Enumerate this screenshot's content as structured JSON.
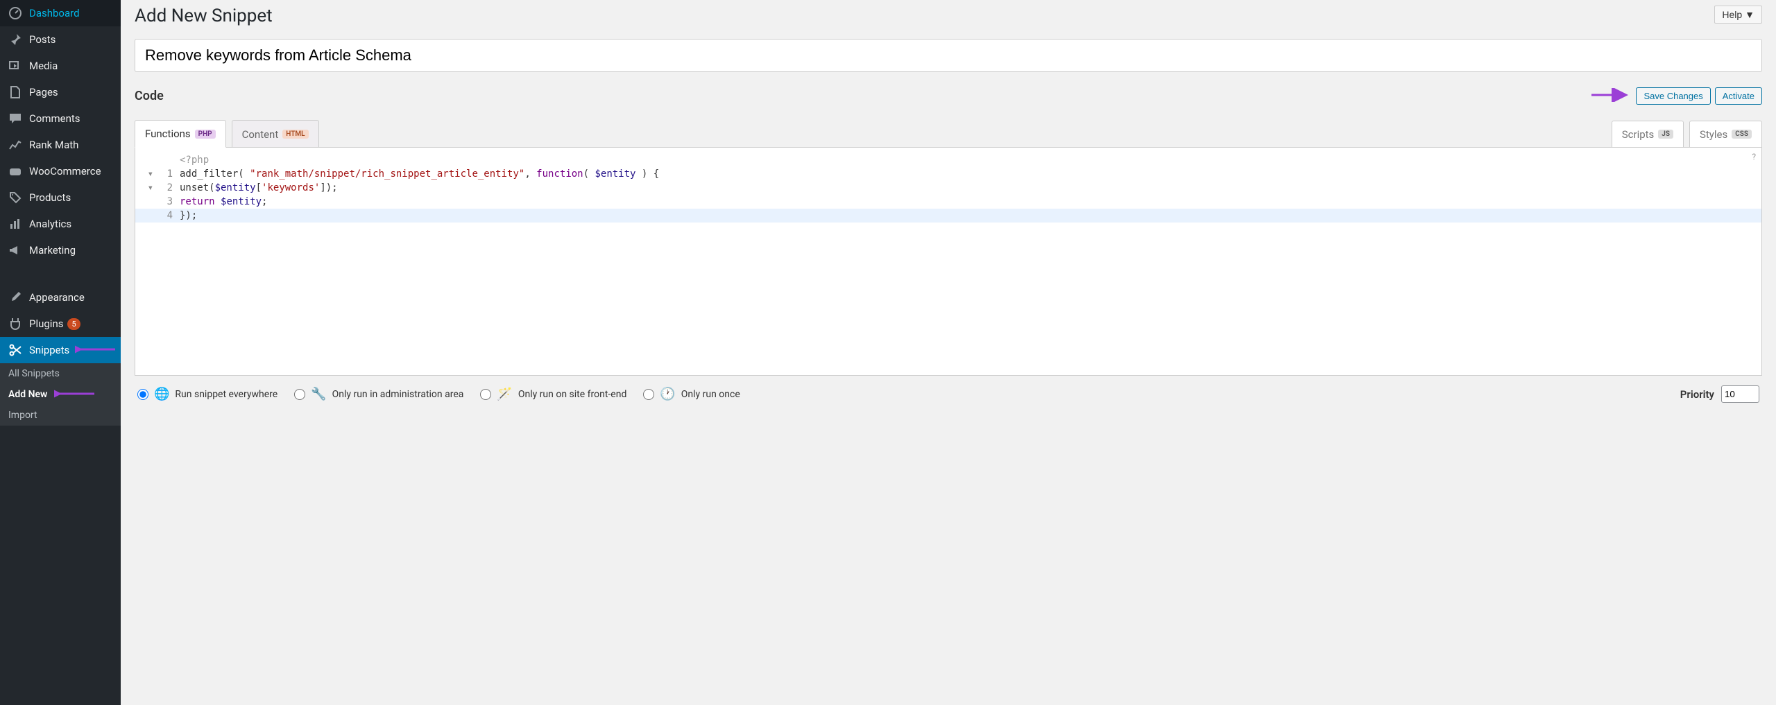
{
  "sidebar": {
    "items": [
      {
        "label": "Dashboard"
      },
      {
        "label": "Posts"
      },
      {
        "label": "Media"
      },
      {
        "label": "Pages"
      },
      {
        "label": "Comments"
      },
      {
        "label": "Rank Math"
      },
      {
        "label": "WooCommerce"
      },
      {
        "label": "Products"
      },
      {
        "label": "Analytics"
      },
      {
        "label": "Marketing"
      },
      {
        "label": "Appearance"
      },
      {
        "label": "Plugins",
        "badge": "5"
      },
      {
        "label": "Snippets"
      }
    ],
    "sub": [
      {
        "label": "All Snippets"
      },
      {
        "label": "Add New"
      },
      {
        "label": "Import"
      }
    ]
  },
  "header": {
    "page_title": "Add New Snippet",
    "help": "Help"
  },
  "title_input": "Remove keywords from Article Schema",
  "code_section": {
    "label": "Code",
    "save": "Save Changes",
    "activate": "Activate"
  },
  "tabs": {
    "functions": {
      "label": "Functions",
      "tag": "PHP"
    },
    "content": {
      "label": "Content",
      "tag": "HTML"
    },
    "scripts": {
      "label": "Scripts",
      "tag": "JS"
    },
    "styles": {
      "label": "Styles",
      "tag": "CSS"
    }
  },
  "editor": {
    "preamble": "<?php",
    "lines": [
      {
        "n": "1",
        "fold": "▾"
      },
      {
        "n": "2",
        "fold": "▾"
      },
      {
        "n": "3",
        "fold": ""
      },
      {
        "n": "4",
        "fold": ""
      }
    ],
    "code": {
      "l1a": "add_filter( ",
      "l1b": "\"rank_math/snippet/rich_snippet_article_entity\"",
      "l1c": ", ",
      "l1d": "function",
      "l1e": "( ",
      "l1f": "$entity",
      "l1g": " ) {",
      "l2a": "unset(",
      "l2b": "$entity",
      "l2c": "[",
      "l2d": "'keywords'",
      "l2e": "]);",
      "l3a": "return",
      "l3b": " ",
      "l3c": "$entity",
      "l3d": ";",
      "l4": "});"
    },
    "help": "?"
  },
  "run": {
    "opt1": "Run snippet everywhere",
    "opt2": "Only run in administration area",
    "opt3": "Only run on site front-end",
    "opt4": "Only run once",
    "priority_label": "Priority",
    "priority_value": "10"
  }
}
